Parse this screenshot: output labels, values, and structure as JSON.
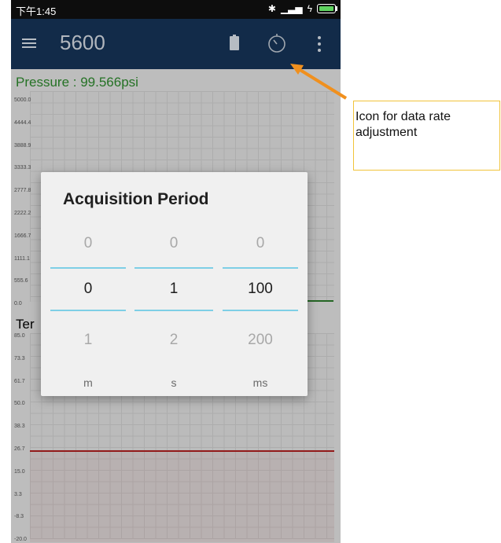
{
  "status_bar": {
    "time": "下午1:45",
    "bluetooth_icon": "bluetooth-icon",
    "signal_icon": "signal-icon",
    "battery_icon": "battery-icon"
  },
  "app_bar": {
    "title": "5600",
    "menu_icon": "hamburger-menu-icon",
    "battery_icon": "battery-icon",
    "timer_icon": "timer-icon",
    "more_icon": "more-vertical-icon"
  },
  "pressure_chart": {
    "title": "Pressure : 99.566psi",
    "title_color": "#2e8b2e",
    "y_ticks": [
      "5000.0",
      "4444.4",
      "3888.9",
      "3333.3",
      "2777.8",
      "2222.2",
      "1666.7",
      "1111.1",
      "555.6",
      "0.0"
    ]
  },
  "temperature_chart": {
    "title": "Ter",
    "y_ticks": [
      "85.0",
      "73.3",
      "61.7",
      "50.0",
      "38.3",
      "26.7",
      "15.0",
      "3.3",
      "-8.3",
      "-20.0"
    ],
    "line_color": "#b32020"
  },
  "dialog": {
    "title": "Acquisition Period",
    "columns": [
      {
        "prev": "0",
        "current": "0",
        "next": "1",
        "unit": "m"
      },
      {
        "prev": "0",
        "current": "1",
        "next": "2",
        "unit": "s"
      },
      {
        "prev": "0",
        "current": "100",
        "next": "200",
        "unit": "ms"
      }
    ]
  },
  "annotation": {
    "text": "Icon for data rate adjustment",
    "arrow_color": "#f0901e",
    "border_color": "#f1c33a"
  }
}
